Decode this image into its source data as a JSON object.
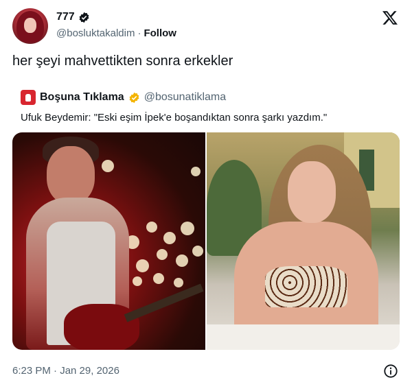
{
  "author": {
    "display_name": "777",
    "handle": "@bosluktakaldim",
    "separator": "·",
    "follow_label": "Follow"
  },
  "tweet": {
    "text": "her şeyi mahvettikten sonra erkekler",
    "timestamp": "6:23 PM · Jan 29, 2026"
  },
  "quote": {
    "name": "Boşuna Tıklama",
    "handle": "@bosunatiklama",
    "text": "Ufuk Beydemir: \"Eski eşim İpek'e boşandıktan sonra şarkı yazdım.\""
  },
  "icons": {
    "verified_badge": "verified-icon",
    "quote_verified_badge": "gold-verified-icon",
    "platform_logo": "x-logo-icon",
    "info": "info-icon"
  },
  "colors": {
    "text_primary": "#0f1419",
    "text_secondary": "#536471",
    "quote_verified": "#f4b400",
    "brand_red": "#d8262f"
  }
}
